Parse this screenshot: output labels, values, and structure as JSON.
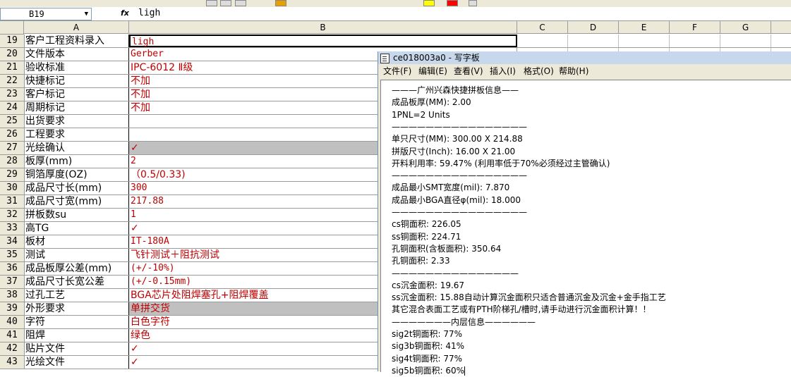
{
  "formula_bar": {
    "cell_ref": "B19",
    "fx": "fx",
    "content": "ligh"
  },
  "columns": [
    "A",
    "B",
    "C",
    "D",
    "E",
    "F",
    "G"
  ],
  "rows": [
    {
      "num": "19",
      "a": "客户工程资料录入",
      "b": "ligh"
    },
    {
      "num": "20",
      "a": "文件版本",
      "b": "Gerber"
    },
    {
      "num": "21",
      "a": "验收标准",
      "b": "IPC-6012 Ⅱ级"
    },
    {
      "num": "22",
      "a": "快捷标记",
      "b": "不加"
    },
    {
      "num": "23",
      "a": "客户标记",
      "b": "不加"
    },
    {
      "num": "24",
      "a": "周期标记",
      "b": "不加"
    },
    {
      "num": "25",
      "a": "出货要求",
      "b": ""
    },
    {
      "num": "26",
      "a": "工程要求",
      "b": ""
    },
    {
      "num": "27",
      "a": "光绘确认",
      "b": "✓"
    },
    {
      "num": "28",
      "a": "板厚(mm)",
      "b": "2"
    },
    {
      "num": "29",
      "a": "铜箔厚度(OZ)",
      "b": "（0.5/0.33)"
    },
    {
      "num": "30",
      "a": "成品尺寸长(mm)",
      "b": "300"
    },
    {
      "num": "31",
      "a": "成品尺寸宽(mm)",
      "b": "217.88"
    },
    {
      "num": "32",
      "a": "拼板数su",
      "b": "1"
    },
    {
      "num": "33",
      "a": "高TG",
      "b": "✓"
    },
    {
      "num": "34",
      "a": "板材",
      "b": "IT-180A"
    },
    {
      "num": "35",
      "a": "测试",
      "b": "飞针测试＋阻抗测试"
    },
    {
      "num": "36",
      "a": "成品板厚公差(mm)",
      "b": "(+/-10%)"
    },
    {
      "num": "37",
      "a": "成品尺寸长宽公差",
      "b": "(+/-0.15mm)"
    },
    {
      "num": "38",
      "a": "过孔工艺",
      "b": "BGA芯片处阻焊塞孔+阻焊覆盖"
    },
    {
      "num": "39",
      "a": "外形要求",
      "b": "单拼交货"
    },
    {
      "num": "40",
      "a": "字符",
      "b": "白色字符"
    },
    {
      "num": "41",
      "a": "阻焊",
      "b": "绿色"
    },
    {
      "num": "42",
      "a": "贴片文件",
      "b": "✓"
    },
    {
      "num": "43",
      "a": "光绘文件",
      "b": "✓"
    }
  ],
  "wordpad": {
    "title": "ce018003a0 - 写字板",
    "menu": [
      "文件(F)",
      "编辑(E)",
      "查看(V)",
      "插入(I)",
      "格式(O)",
      "帮助(H)"
    ],
    "lines": [
      "———广州兴森快捷拼板信息——",
      "成品板厚(MM): 2.00",
      "1PNL=2 Units",
      "————————————————",
      "单只尺寸(MM): 300.00 X 214.88",
      "拼版尺寸(Inch): 16.00 X 21.00",
      "开料利用率: 59.47% (利用率低于70%必须经过主管确认)",
      "————————————————",
      "成品最小SMT宽度(mil): 7.870",
      "成品最小BGA直径φ(mil): 18.000",
      "————————————————",
      "cs铜面积: 226.05",
      "ss铜面积: 224.71",
      "孔铜面积(含板面积): 350.64",
      "孔铜面积: 2.33",
      "———————————————",
      "cs沉金面积: 19.67",
      "ss沉金面积: 15.88自动计算沉金面积只适合普通沉金及沉金+金手指工艺",
      "其它混合表面工艺或有PTH阶梯孔/槽时,请手动进行沉金面积计算！！",
      "———————内层信息——————",
      "sig2t铜面积: 77%",
      "sig3b铜面积: 41%",
      "sig4t铜面积: 77%",
      "sig5b铜面积: 60%"
    ]
  },
  "colors": {
    "cell_red": "#c00000",
    "header_gray": "#ece9d8",
    "shade_gray": "#c0c0c0"
  }
}
